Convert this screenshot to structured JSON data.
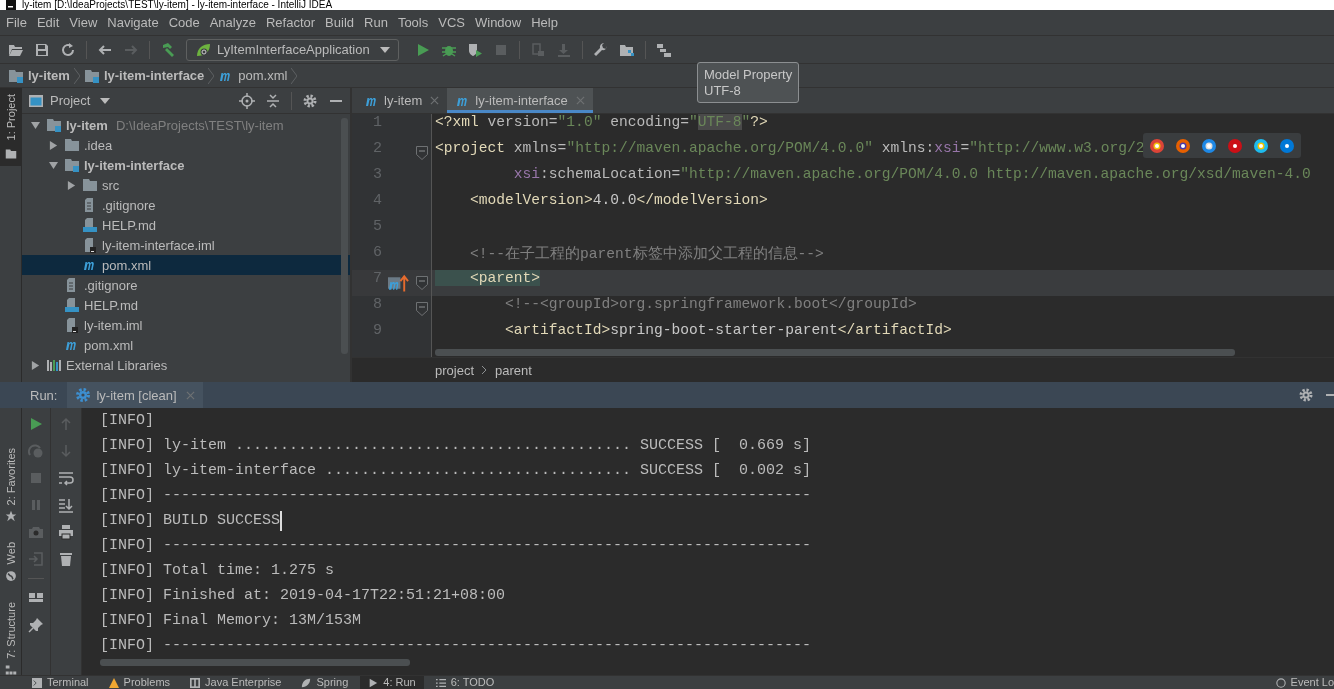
{
  "window": {
    "title": "ly-item [D:\\IdeaProjects\\TEST\\ly-item] - ly-item-interface - IntelliJ IDEA"
  },
  "menu": [
    "File",
    "Edit",
    "View",
    "Navigate",
    "Code",
    "Analyze",
    "Refactor",
    "Build",
    "Run",
    "Tools",
    "VCS",
    "Window",
    "Help"
  ],
  "toolbar": {
    "run_configuration": "LyItemInterfaceApplication"
  },
  "navigation": [
    {
      "label": "ly-item",
      "kind": "module"
    },
    {
      "label": "ly-item-interface",
      "kind": "module"
    },
    {
      "label": "pom.xml",
      "kind": "maven"
    }
  ],
  "left_stripe": [
    {
      "label": "1: Project",
      "selected": true
    }
  ],
  "project": {
    "title": "Project",
    "tree": [
      {
        "label": "ly-item",
        "kind": "module",
        "path": "D:\\IdeaProjects\\TEST\\ly-item",
        "expanded": true,
        "selected": false,
        "children": [
          {
            "label": ".idea",
            "kind": "folder",
            "expanded": false,
            "selected": false
          },
          {
            "label": "ly-item-interface",
            "kind": "module",
            "expanded": true,
            "selected": false,
            "children": [
              {
                "label": "src",
                "kind": "folder",
                "expanded": false,
                "selected": false
              },
              {
                "label": ".gitignore",
                "kind": "file",
                "selected": false
              },
              {
                "label": "HELP.md",
                "kind": "markdown",
                "selected": false
              },
              {
                "label": "ly-item-interface.iml",
                "kind": "iml",
                "selected": false
              },
              {
                "label": "pom.xml",
                "kind": "maven",
                "selected": true
              }
            ]
          },
          {
            "label": ".gitignore",
            "kind": "file",
            "selected": false
          },
          {
            "label": "HELP.md",
            "kind": "markdown",
            "selected": false
          },
          {
            "label": "ly-item.iml",
            "kind": "iml",
            "selected": false
          },
          {
            "label": "pom.xml",
            "kind": "maven",
            "selected": false
          }
        ]
      },
      {
        "label": "External Libraries",
        "kind": "libraries",
        "expanded": false,
        "selected": false
      }
    ]
  },
  "editor": {
    "tabs": [
      {
        "label": "ly-item",
        "selected": false
      },
      {
        "label": "ly-item-interface",
        "selected": true
      }
    ],
    "tooltip": {
      "title": "Model Property",
      "value": "UTF-8"
    },
    "lines": [
      {
        "number": "1",
        "fold": false,
        "marker": false,
        "current": false,
        "tokens": [
          {
            "kind": "tag",
            "text": "<?xml "
          },
          {
            "kind": "attr",
            "text": "version="
          },
          {
            "kind": "string",
            "text": "\"1.0\""
          },
          {
            "kind": "attr",
            "text": " encoding="
          },
          {
            "kind": "string",
            "text": "\""
          },
          {
            "kind": "string_hl",
            "text": "UTF-8"
          },
          {
            "kind": "string",
            "text": "\""
          },
          {
            "kind": "tag",
            "text": "?>"
          }
        ]
      },
      {
        "number": "2",
        "fold": true,
        "marker": false,
        "current": false,
        "tokens": [
          {
            "kind": "tag",
            "text": "<project "
          },
          {
            "kind": "attr",
            "text": "xmlns="
          },
          {
            "kind": "string",
            "text": "\"http://maven.apache.org/POM/4.0.0\""
          },
          {
            "kind": "attr",
            "text": " xmlns:"
          },
          {
            "kind": "ns",
            "text": "xsi"
          },
          {
            "kind": "attr",
            "text": "="
          },
          {
            "kind": "string",
            "text": "\"http://www.w3.org/2"
          }
        ]
      },
      {
        "number": "3",
        "fold": false,
        "marker": false,
        "current": false,
        "tokens": [
          {
            "kind": "ns",
            "text": "         xsi"
          },
          {
            "kind": "attr",
            "text": ":schemaLocation="
          },
          {
            "kind": "string",
            "text": "\"http://maven.apache.org/POM/4.0.0 http://maven.apache.org/xsd/maven-4.0"
          }
        ]
      },
      {
        "number": "4",
        "fold": false,
        "marker": false,
        "current": false,
        "tokens": [
          {
            "kind": "tag",
            "text": "    <modelVersion>"
          },
          {
            "kind": "text",
            "text": "4.0.0"
          },
          {
            "kind": "tag",
            "text": "</modelVersion>"
          }
        ]
      },
      {
        "number": "5",
        "fold": false,
        "marker": false,
        "current": false
      },
      {
        "number": "6",
        "fold": false,
        "marker": false,
        "current": false,
        "tokens": [
          {
            "kind": "comment",
            "text": "    <!--在子工程的parent标签中添加父工程的信息-->"
          }
        ]
      },
      {
        "number": "7",
        "fold": true,
        "marker": true,
        "current": true,
        "tokens": [
          {
            "kind": "tag_hl",
            "text": "    <parent>"
          }
        ]
      },
      {
        "number": "8",
        "fold": true,
        "marker": false,
        "current": false,
        "tokens": [
          {
            "kind": "comment",
            "text": "        <!--<groupId>org.springframework.boot</groupId>"
          }
        ]
      },
      {
        "number": "9",
        "fold": false,
        "marker": false,
        "current": false,
        "tokens": [
          {
            "kind": "tag",
            "text": "        <artifactId>"
          },
          {
            "kind": "text",
            "text": "spring-boot-starter-parent"
          },
          {
            "kind": "tag",
            "text": "</artifactId>"
          }
        ]
      }
    ],
    "breadcrumbs": [
      "project",
      "parent"
    ]
  },
  "run": {
    "label": "Run:",
    "tab": "ly-item [clean]",
    "side_tabs": [
      {
        "label": "2: Favorites",
        "kind": "favorites"
      },
      {
        "label": "Web",
        "kind": "web"
      },
      {
        "label": "7: Structure",
        "kind": "structure"
      }
    ],
    "console": [
      {
        "text": "[INFO]",
        "caret": false
      },
      {
        "text": "[INFO] ly-item ............................................ SUCCESS [  0.669 s]",
        "caret": false
      },
      {
        "text": "[INFO] ly-item-interface .................................. SUCCESS [  0.002 s]",
        "caret": false
      },
      {
        "text": "[INFO] ------------------------------------------------------------------------",
        "caret": false
      },
      {
        "text": "[INFO] BUILD SUCCESS",
        "caret": true
      },
      {
        "text": "[INFO] ------------------------------------------------------------------------",
        "caret": false
      },
      {
        "text": "[INFO] Total time: 1.275 s",
        "caret": false
      },
      {
        "text": "[INFO] Finished at: 2019-04-17T22:51:21+08:00",
        "caret": false
      },
      {
        "text": "[INFO] Final Memory: 13M/153M",
        "caret": false
      },
      {
        "text": "[INFO] ------------------------------------------------------------------------",
        "caret": false
      }
    ]
  },
  "status_bar": {
    "tabs": [
      {
        "label": "Terminal",
        "kind": "terminal",
        "selected": false
      },
      {
        "label": "Problems",
        "kind": "problems",
        "selected": false
      },
      {
        "label": "Java Enterprise",
        "kind": "enterprise",
        "selected": false
      },
      {
        "label": "Spring",
        "kind": "spring",
        "selected": false
      },
      {
        "label": "4: Run",
        "kind": "run",
        "selected": true
      },
      {
        "label": "6: TODO",
        "kind": "todo",
        "selected": false
      }
    ],
    "event_log": "Event Lo"
  }
}
